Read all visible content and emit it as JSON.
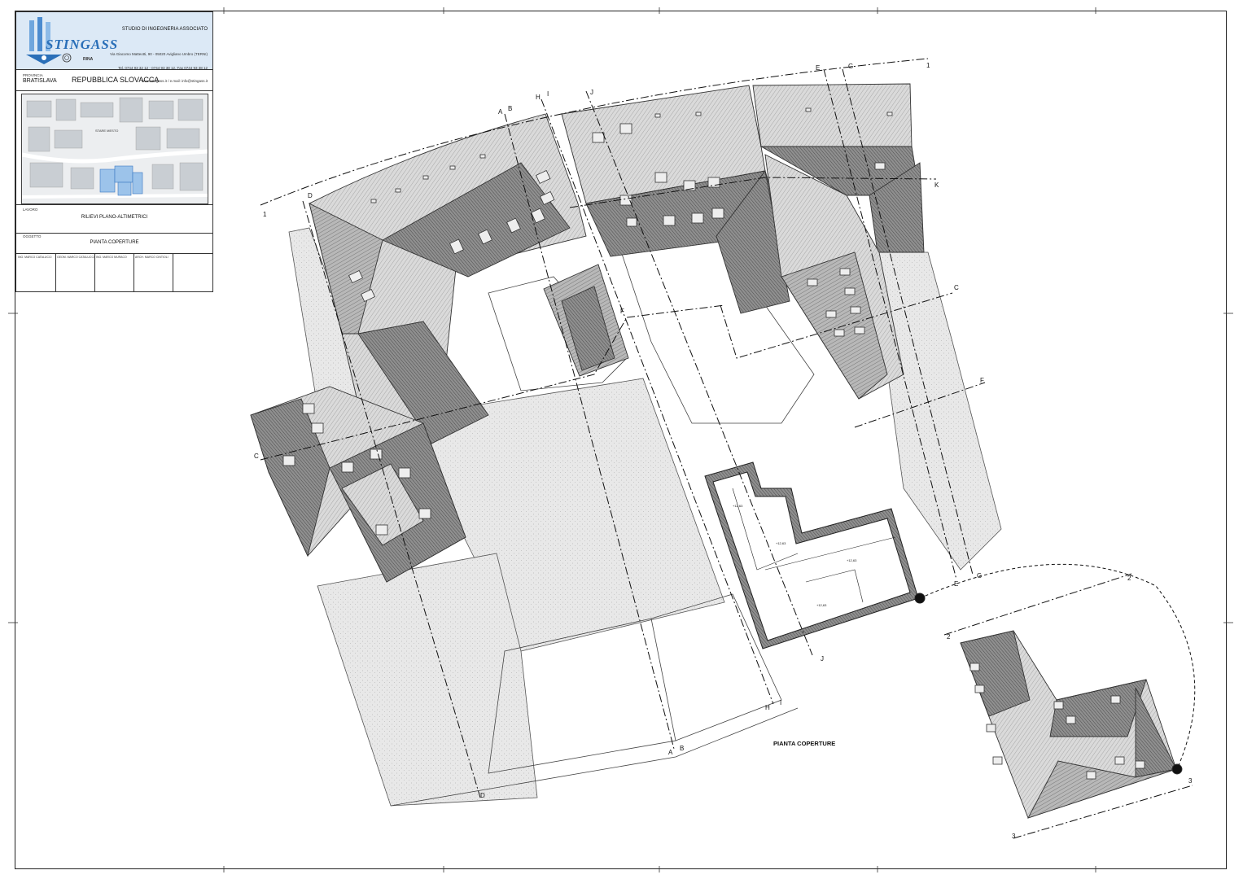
{
  "firm": {
    "logo_text": "STINGASS",
    "studio_name": "STUDIO DI INGEGNERIA ASSOCIATO",
    "address_lines": [
      "Via Giacomo Matteotti, 90 - 05020 Avigliano Umbro (TERNI)",
      "Tel. 0744 93 32 12 - 0744 93 38 12, Fax 0744 93 38 12",
      "www.stingass.it / e.mail: info@stingass.it"
    ],
    "cert_label": "RINA"
  },
  "project": {
    "province_label": "PROVINCIA",
    "country": "REPUBBLICA SLOVACCA",
    "city": "BRATISLAVA",
    "map_label": "STARE MESTO",
    "work_label": "LAVORO",
    "work_title": "RILIEVI PLANO-ALTIMETRICI",
    "subject_label": "OGGETTO",
    "subject_title": "PIANTA COPERTURE"
  },
  "signatures": [
    "ING. MARCO CATALUCCI",
    "GEOM. MARCO CATALUCCI",
    "ING. MARCO MURACO",
    "ARCH. MARCO CINTIOLI",
    ""
  ],
  "drawing": {
    "caption": "PIANTA COPERTURE",
    "section_marks": [
      "A",
      "B",
      "C",
      "D",
      "E",
      "F",
      "G",
      "H",
      "I",
      "J",
      "K"
    ],
    "level_labels": [
      "+12,63",
      "+12,63",
      "+12,63",
      "+12,63"
    ]
  },
  "colors": {
    "roof_light": "#d9d9d9",
    "roof_dark": "#8c8c8c",
    "paving": "#e6e6e6",
    "line": "#222222",
    "logo_blue": "#2a6fb8"
  }
}
